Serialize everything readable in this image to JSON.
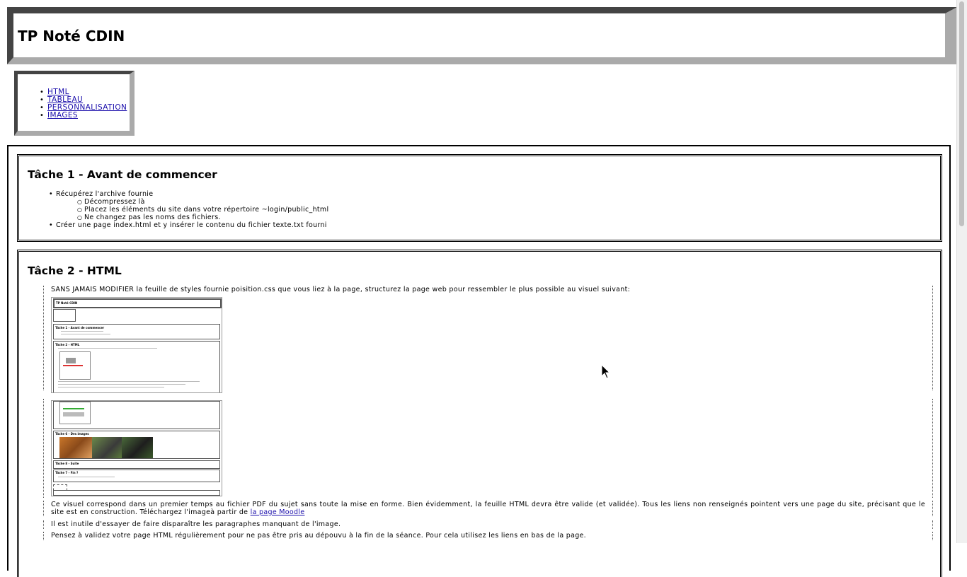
{
  "header": {
    "title": "TP Noté CDIN"
  },
  "nav": {
    "items": [
      "HTML",
      "TABLEAU",
      "PERSONNALISATION",
      "IMAGES"
    ]
  },
  "task1": {
    "title": "Tâche 1 - Avant de commencer",
    "item1": "Récupérez l'archive fournie",
    "subitems": [
      "Décompressez là",
      "Placez les éléments du site dans votre répertoire ~login/public_html",
      "Ne changez pas les noms des fichiers."
    ],
    "item2": "Créer une page index.html et y insérer le contenu du fichier texte.txt fourni"
  },
  "task2": {
    "title": "Tâche 2 - HTML",
    "p1": "SANS JAMAIS MODIFIER la feuille de styles fournie poisition.css que vous liez à la page, structurez la page web pour ressembler le plus possible au visuel suivant:",
    "p3_before": "Ce visuel correspond dans un premier temps au fichier PDF du sujet sans toute la mise en forme. Bien évidemment, la feuille HTML devra être valide (et validée). Tous les liens non renseignés pointent vers une page du site, précisant que le site est en construction. Téléchargez l'imageà partir de ",
    "p3_link": "la page Moodle",
    "p4": "Il est inutile d'essayer de faire disparaître les paragraphes manquant de l'image.",
    "p5": "Pensez à validez votre page HTML régulièrement pour ne pas être pris au dépouvu à la fin de la séance. Pour cela utilisez les liens en bas de la page."
  },
  "thumb": {
    "title": "TP Noté CDIN",
    "t1": "Tâche 1 - Avant de commencer",
    "t2": "Tâche 2 - HTML",
    "t6": "Tâche 6 - Des images",
    "t8": "Tâche 8 - Suite",
    "t7": "Tâche 7 - Fin ?"
  }
}
